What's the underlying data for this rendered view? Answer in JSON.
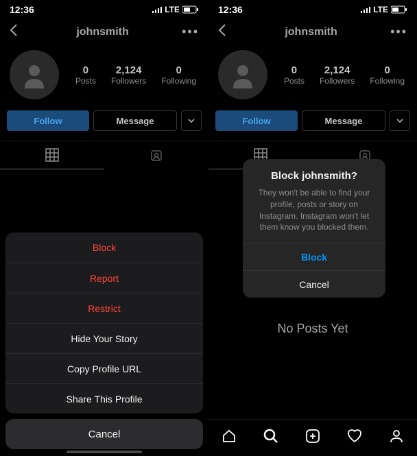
{
  "status": {
    "time": "12:36",
    "network": "LTE"
  },
  "profile": {
    "username": "johnsmith"
  },
  "stats": {
    "posts_num": "0",
    "posts_label": "Posts",
    "followers_num": "2,124",
    "followers_label": "Followers",
    "following_num": "0",
    "following_label": "Following"
  },
  "buttons": {
    "follow": "Follow",
    "message": "Message"
  },
  "sheet": {
    "block": "Block",
    "report": "Report",
    "restrict": "Restrict",
    "hide": "Hide Your Story",
    "copy": "Copy Profile URL",
    "share": "Share This Profile",
    "cancel": "Cancel"
  },
  "modal": {
    "title": "Block johnsmith?",
    "body": "They won't be able to find your profile, posts or story on Instagram. Instagram won't let them know you blocked them.",
    "block": "Block",
    "cancel": "Cancel"
  },
  "empty": "No Posts Yet"
}
